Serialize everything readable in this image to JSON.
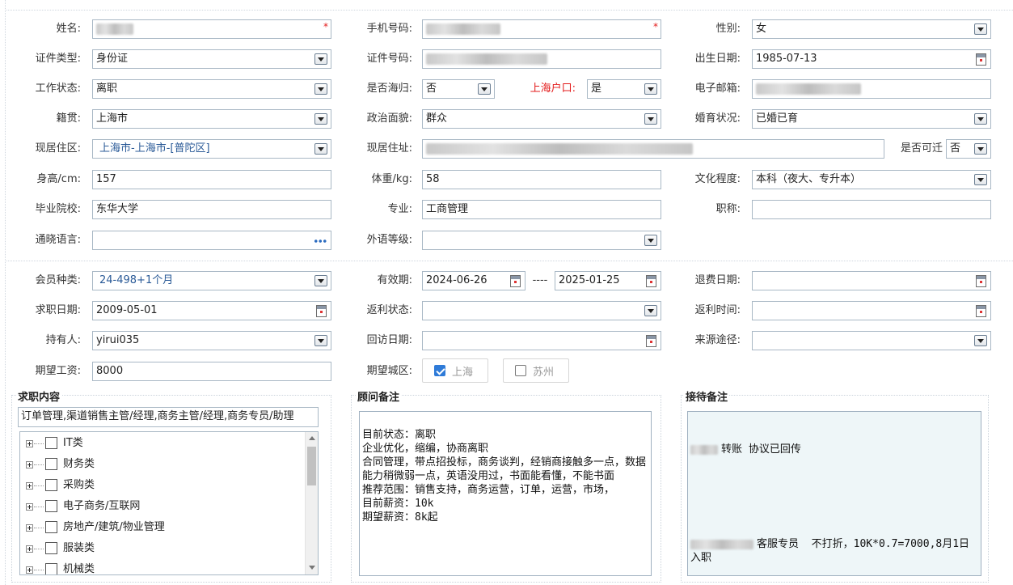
{
  "basic": {
    "name": {
      "label": "姓名:",
      "value": ""
    },
    "mobile": {
      "label": "手机号码:",
      "value": ""
    },
    "gender": {
      "label": "性别:",
      "value": "女"
    },
    "id_type": {
      "label": "证件类型:",
      "value": "身份证"
    },
    "id_no": {
      "label": "证件号码:",
      "value": ""
    },
    "birth": {
      "label": "出生日期:",
      "value": "1985-07-13"
    },
    "work_status": {
      "label": "工作状态:",
      "value": "离职"
    },
    "returnee": {
      "label": "是否海归:",
      "value": "否"
    },
    "sh_hukou": {
      "label": "上海户口:",
      "value": "是"
    },
    "email": {
      "label": "电子邮箱:",
      "value": ""
    },
    "native": {
      "label": "籍贯:",
      "value": "上海市"
    },
    "politics": {
      "label": "政治面貌:",
      "value": "群众"
    },
    "marital": {
      "label": "婚育状况:",
      "value": "已婚已育"
    },
    "district": {
      "label": "现居住区:",
      "value": "上海市-上海市-[普陀区]"
    },
    "address": {
      "label": "现居住址:",
      "value": ""
    },
    "relocate": {
      "label": "是否可迁",
      "value": "否"
    },
    "height": {
      "label": "身高/cm:",
      "value": "157"
    },
    "weight": {
      "label": "体重/kg:",
      "value": "58"
    },
    "education": {
      "label": "文化程度:",
      "value": "本科（夜大、专升本）"
    },
    "school": {
      "label": "毕业院校:",
      "value": "东华大学"
    },
    "major": {
      "label": "专业:",
      "value": "工商管理"
    },
    "title": {
      "label": "职称:",
      "value": ""
    },
    "languages": {
      "label": "通晓语言:",
      "value": ""
    },
    "foreign_level": {
      "label": "外语等级:",
      "value": ""
    }
  },
  "member": {
    "type": {
      "label": "会员种类:",
      "value": "24-498+1个月"
    },
    "valid": {
      "label": "有效期:",
      "from": "2024-06-26",
      "sep": "----",
      "to": "2025-01-25"
    },
    "refund_date": {
      "label": "退费日期:",
      "value": ""
    },
    "job_date": {
      "label": "求职日期:",
      "value": "2009-05-01"
    },
    "rebate_status": {
      "label": "返利状态:",
      "value": ""
    },
    "rebate_time": {
      "label": "返利时间:",
      "value": ""
    },
    "holder": {
      "label": "持有人:",
      "value": "yirui035"
    },
    "visit_date": {
      "label": "回访日期:",
      "value": ""
    },
    "source": {
      "label": "来源途径:",
      "value": ""
    },
    "salary": {
      "label": "期望工资:",
      "value": "8000"
    },
    "city": {
      "label": "期望城区:",
      "options": [
        {
          "label": "上海",
          "checked": true
        },
        {
          "label": "苏州",
          "checked": false
        }
      ]
    }
  },
  "job_content": {
    "title": "求职内容",
    "summary": "订单管理,渠道销售主管/经理,商务主管/经理,商务专员/助理",
    "tree": [
      "IT类",
      "财务类",
      "采购类",
      "电子商务/互联网",
      "房地产/建筑/物业管理",
      "服装类",
      "机械类"
    ]
  },
  "advisor_note": {
    "title": "顾问备注",
    "text": "目前状态：离职\n企业优化，缩编，协商离职\n合同管理，带点招投标，商务谈判，经销商接触多一点，数据能力稍微弱一点，英语没用过，书面能看懂，不能书面\n推荐范围：销售支持，商务运营，订单，运营，市场，\n目前薪资：10k\n期望薪资：8k起"
  },
  "reception_note": {
    "title": "接待备注",
    "line1": "转账 协议已回传",
    "line2": "客服专员  不打折，10K*0.7=7000,8月1日入职"
  },
  "colors": {
    "border": "#a9b8c5",
    "required": "#e31b1b",
    "accent": "#2f7bd8"
  }
}
